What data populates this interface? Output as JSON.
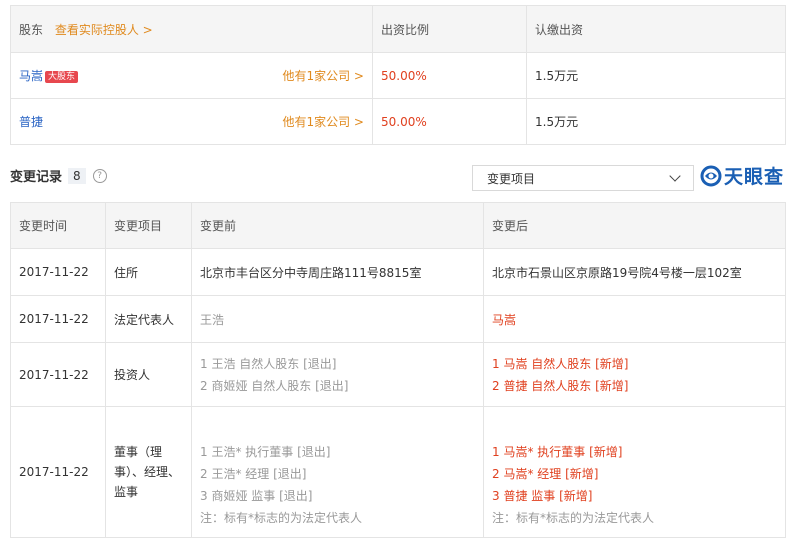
{
  "shareholders": {
    "header": {
      "col1": "股东",
      "view_link": "查看实际控股人 >",
      "col2": "出资比例",
      "col3": "认缴出资"
    },
    "rows": [
      {
        "name": "马嵩",
        "tag": "大股东",
        "link": "他有1家公司 >",
        "ratio": "50.00%",
        "amount": "1.5万元"
      },
      {
        "name": "普捷",
        "tag": "",
        "link": "他有1家公司 >",
        "ratio": "50.00%",
        "amount": "1.5万元"
      }
    ]
  },
  "changes": {
    "title": "变更记录",
    "count": "8",
    "help_icon": "?",
    "select_label": "变更项目",
    "logo_text": "天眼查",
    "header": {
      "time": "变更时间",
      "item": "变更项目",
      "before": "变更前",
      "after": "变更后"
    },
    "rows": [
      {
        "time": "2017-11-22",
        "item": "住所",
        "before": [
          "北京市丰台区分中寺周庄路111号8815室"
        ],
        "after": [
          "北京市石景山区京原路19号院4号楼一层102室"
        ]
      },
      {
        "time": "2017-11-22",
        "item": "法定代表人",
        "before": [
          "王浩"
        ],
        "after": [
          "马嵩"
        ]
      },
      {
        "time": "2017-11-22",
        "item": "投资人",
        "before": [
          "1 王浩 自然人股东 [退出]",
          "2 商姬娅 自然人股东 [退出]"
        ],
        "after": [
          "1 马嵩 自然人股东 [新增]",
          "2 普捷 自然人股东 [新增]"
        ]
      },
      {
        "time": "2017-11-22",
        "item": "董事（理事）、经理、监事",
        "before": [
          "1 王浩* 执行董事 [退出]",
          "2 王浩* 经理 [退出]",
          "3 商姬娅 监事 [退出]"
        ],
        "before_note": "注：标有*标志的为法定代表人",
        "after": [
          "1 马嵩* 执行董事 [新增]",
          "2 马嵩* 经理 [新增]",
          "3 普捷 监事 [新增]"
        ],
        "after_note": "注：标有*标志的为法定代表人"
      }
    ]
  }
}
